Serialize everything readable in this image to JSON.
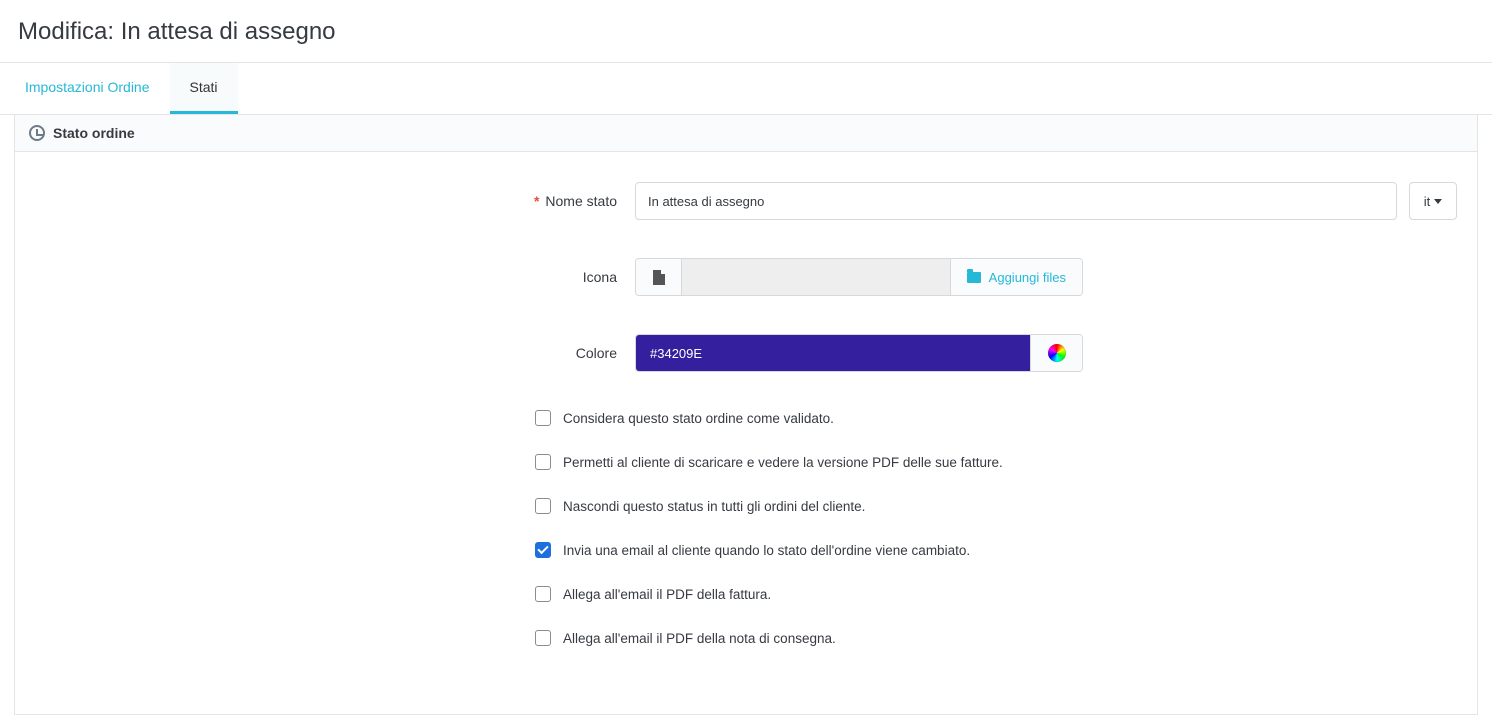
{
  "page_title": "Modifica: In attesa di assegno",
  "tabs": [
    {
      "label": "Impostazioni Ordine",
      "active": false
    },
    {
      "label": "Stati",
      "active": true
    }
  ],
  "panel": {
    "title": "Stato ordine"
  },
  "form": {
    "name_label": "Nome stato",
    "name_value": "In attesa di assegno",
    "lang": "it",
    "icon_label": "Icona",
    "add_files_label": "Aggiungi files",
    "color_label": "Colore",
    "color_value": "#34209E"
  },
  "checkboxes": [
    {
      "label": "Considera questo stato ordine come validato.",
      "checked": false
    },
    {
      "label": "Permetti al cliente di scaricare e vedere la versione PDF delle sue fatture.",
      "checked": false
    },
    {
      "label": "Nascondi questo status in tutti gli ordini del cliente.",
      "checked": false
    },
    {
      "label": "Invia una email al cliente quando lo stato dell'ordine viene cambiato.",
      "checked": true
    },
    {
      "label": "Allega all'email il PDF della fattura.",
      "checked": false
    },
    {
      "label": "Allega all'email il PDF della nota di consegna.",
      "checked": false
    }
  ]
}
